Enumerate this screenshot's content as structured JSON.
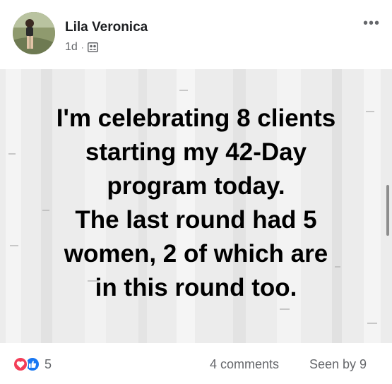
{
  "post": {
    "author": "Lila Veronica",
    "time": "1d",
    "separator": "·",
    "audience_icon": "group-icon",
    "more_label": "•••",
    "text_lines": [
      "I'm celebrating 8 clients",
      "starting my 42-Day",
      "program today.",
      "The last round had 5",
      "women, 2 of which are",
      "in this round too."
    ]
  },
  "footer": {
    "reaction_icons": [
      "love-icon",
      "like-icon"
    ],
    "reaction_count": "5",
    "comments": "4 comments",
    "seen": "Seen by 9"
  },
  "colors": {
    "love": "#f33e58",
    "like": "#1877f2",
    "meta_text": "#65676b",
    "name_text": "#1c1e21"
  }
}
